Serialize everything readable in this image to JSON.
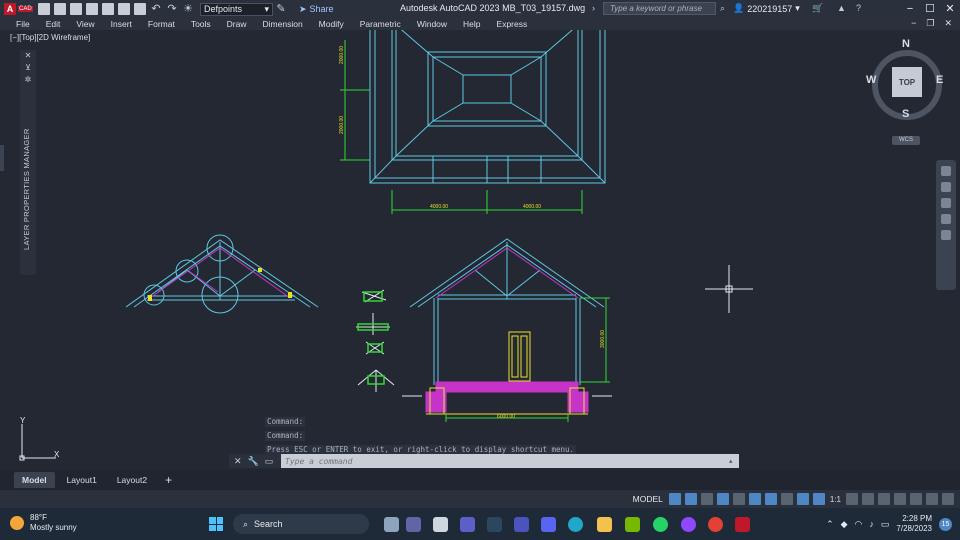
{
  "titlebar": {
    "layer": "Defpoints",
    "share": "Share",
    "doc_title": "Autodesk AutoCAD 2023    MB_T03_19157.dwg",
    "search_placeholder": "Type a keyword or phrase",
    "user": "220219157"
  },
  "menus": [
    "File",
    "Edit",
    "View",
    "Insert",
    "Format",
    "Tools",
    "Draw",
    "Dimension",
    "Modify",
    "Parametric",
    "Window",
    "Help",
    "Express"
  ],
  "viewport": {
    "label": "[−][Top][2D Wireframe]",
    "layer_palette_title": "LAYER PROPERTIES MANAGER",
    "viewcube": {
      "face": "TOP",
      "n": "N",
      "s": "S",
      "e": "E",
      "w": "W",
      "wcs": "WCS"
    },
    "dims": {
      "plan_left_1": "2000.00",
      "plan_left_2": "2000.00",
      "plan_bottom_1": "4000.00",
      "plan_bottom_2": "4000.00",
      "section_height": "3000.00",
      "section_width": "6000.00"
    },
    "ucs": {
      "x": "X",
      "y": "Y"
    }
  },
  "command": {
    "history": [
      "Command:",
      "Command:",
      "Press ESC or ENTER to exit, or right-click to display shortcut menu."
    ],
    "placeholder": "Type a command"
  },
  "layout_tabs": [
    "Model",
    "Layout1",
    "Layout2"
  ],
  "statusbar": {
    "model": "MODEL",
    "scale": "1:1"
  },
  "taskbar": {
    "temp": "88°F",
    "weather": "Mostly sunny",
    "search": "Search",
    "time": "2:28 PM",
    "date": "7/28/2023",
    "notifications": "15"
  },
  "colors": {
    "cyan": "#5fc7e0",
    "green": "#2fdc2f",
    "yellow": "#e8e02a",
    "magenta": "#c533c9",
    "white": "#e6e9ef"
  }
}
